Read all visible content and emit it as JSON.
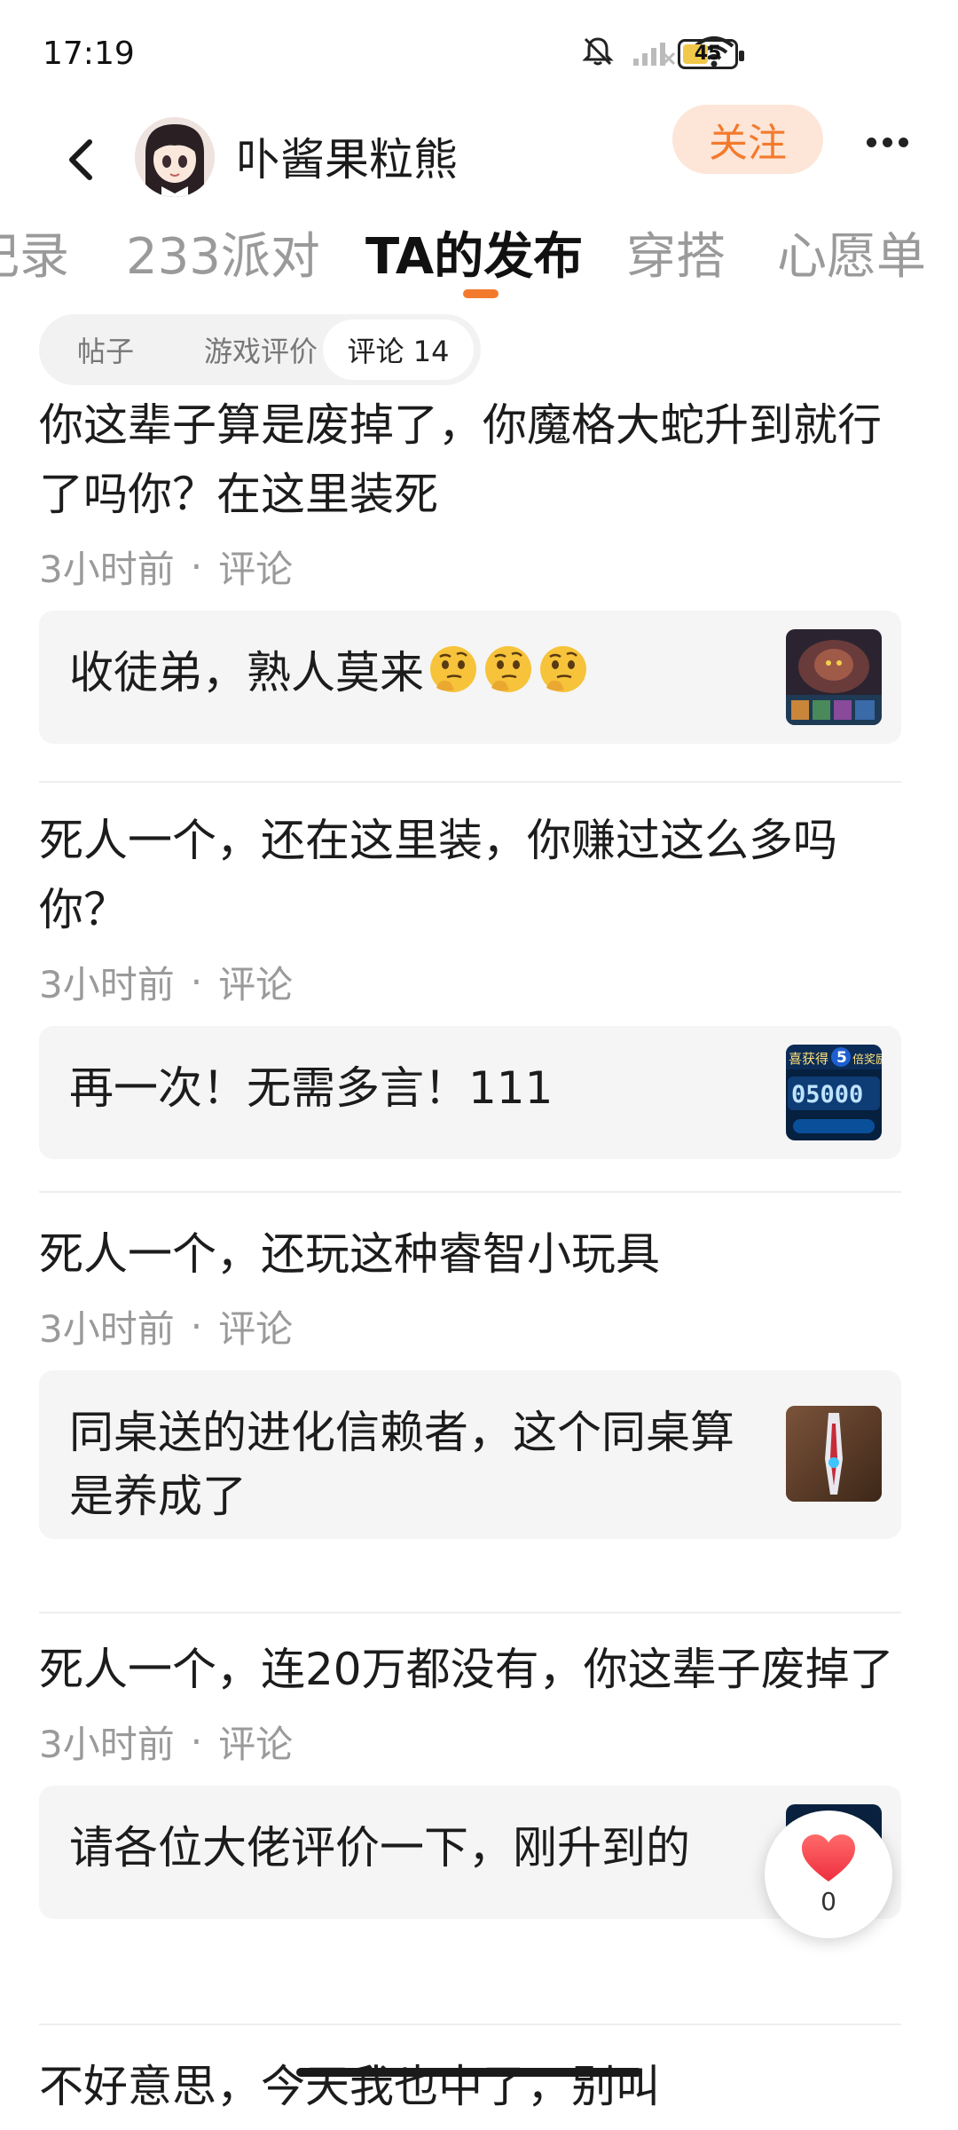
{
  "status_bar": {
    "time": "17:19",
    "battery": "45"
  },
  "header": {
    "username": "卟酱果粒熊",
    "follow_label": "关注"
  },
  "tabs": [
    {
      "label": "记录"
    },
    {
      "label": "233派对"
    },
    {
      "label": "TA的发布"
    },
    {
      "label": "穿搭"
    },
    {
      "label": "心愿单"
    }
  ],
  "subtabs": [
    {
      "label": "帖子"
    },
    {
      "label": "游戏评价"
    },
    {
      "label": "评论 14"
    }
  ],
  "meta_separator": "·",
  "posts": [
    {
      "text": "你这辈子算是废掉了，你魔格大蛇升到就行了吗你？在这里装死",
      "time": "3小时前",
      "type": "评论",
      "quote": "收徒弟，熟人莫来"
    },
    {
      "text": "死人一个，还在这里装，你赚过这么多吗你？",
      "time": "3小时前",
      "type": "评论",
      "quote": "再一次！无需多言！111"
    },
    {
      "text": "死人一个，还玩这种睿智小玩具",
      "time": "3小时前",
      "type": "评论",
      "quote": "同桌送的进化信赖者，这个同桌算是养成了"
    },
    {
      "text": "死人一个，连20万都没有，你这辈子废掉了",
      "time": "3小时前",
      "type": "评论",
      "quote": "请各位大佬评价一下，刚升到的"
    },
    {
      "text": "不好意思，今天我也中了，别叫"
    }
  ],
  "thumb2_text": {
    "top_left": "喜获得",
    "badge": "5",
    "top_right": "倍奖励!",
    "number": "05000"
  },
  "like_fab": {
    "count": "0"
  },
  "colors": {
    "accent": "#f37a2c",
    "follow_bg": "#fde5d8",
    "card_bg": "#f5f5f5",
    "muted": "#9a9a9a"
  },
  "icons": [
    "back-icon",
    "bell-muted-icon",
    "signal-icon",
    "wifi-icon",
    "battery-icon",
    "more-icon",
    "thinking-emoji",
    "heart-icon"
  ]
}
